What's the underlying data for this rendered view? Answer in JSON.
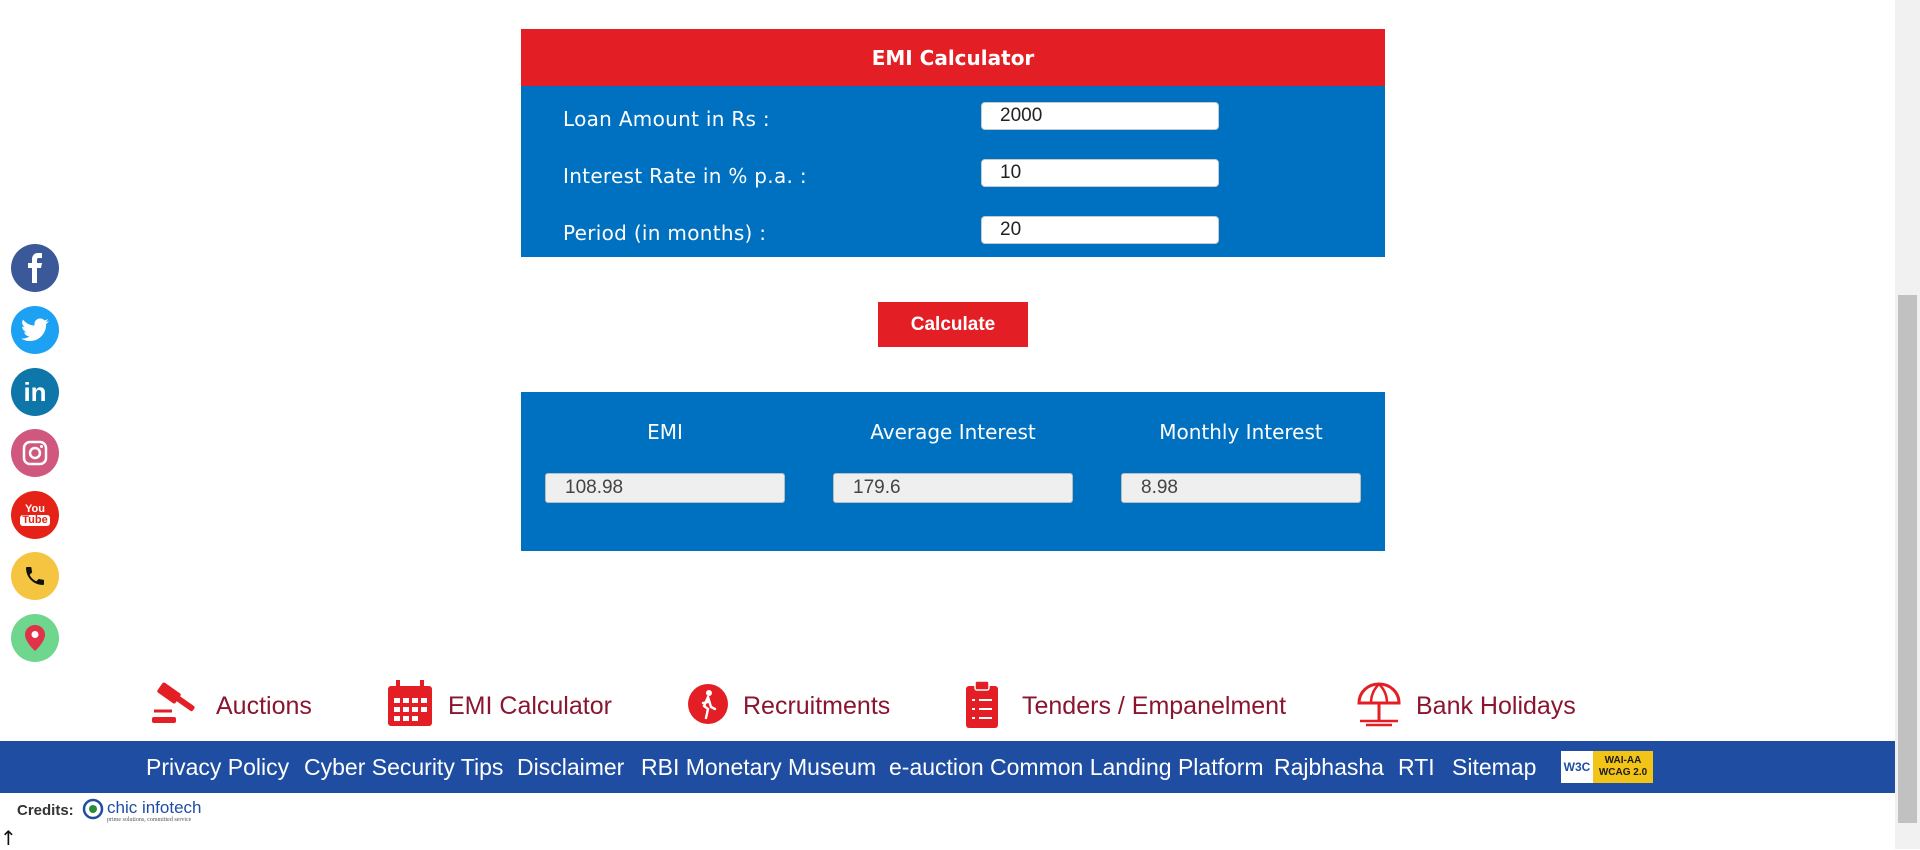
{
  "emi_calculator": {
    "title": "EMI Calculator",
    "fields": [
      {
        "label": "Loan Amount in Rs :",
        "value": "2000"
      },
      {
        "label": "Interest Rate in % p.a. :",
        "value": "10"
      },
      {
        "label": "Period (in months) :",
        "value": "20"
      }
    ],
    "calculate_label": "Calculate",
    "results": [
      {
        "label": "EMI",
        "value": "108.98"
      },
      {
        "label": "Average Interest",
        "value": "179.6"
      },
      {
        "label": "Monthly Interest",
        "value": "8.98"
      }
    ]
  },
  "social_icons": [
    {
      "name": "facebook-icon",
      "color": "#3b5998",
      "glyph": "f"
    },
    {
      "name": "twitter-icon",
      "color": "#1da1f2",
      "glyph": ""
    },
    {
      "name": "linkedin-icon",
      "color": "#0e76a8",
      "glyph": "in"
    },
    {
      "name": "instagram-icon",
      "color": "#d0587e",
      "glyph": ""
    },
    {
      "name": "youtube-icon",
      "color": "#e62117",
      "glyph": ""
    },
    {
      "name": "phone-icon",
      "color": "#f5c542",
      "glyph": ""
    },
    {
      "name": "location-icon",
      "color": "#6fd68d",
      "glyph": ""
    }
  ],
  "quick_links": [
    {
      "label": "Auctions",
      "icon": "gavel-icon"
    },
    {
      "label": "EMI Calculator",
      "icon": "calendar-icon"
    },
    {
      "label": "Recruitments",
      "icon": "walking-person-icon"
    },
    {
      "label": "Tenders / Empanelment",
      "icon": "clipboard-icon"
    },
    {
      "label": "Bank Holidays",
      "icon": "beach-umbrella-icon"
    }
  ],
  "footer_links": [
    "Privacy Policy",
    "Cyber Security Tips",
    "Disclaimer",
    "RBI Monetary Museum",
    "e-auction Common Landing Platform",
    "Rajbhasha",
    "RTI",
    "Sitemap"
  ],
  "wcag_badge": {
    "w3c": "W3C",
    "line1": "WAI-AA",
    "line2": "WCAG 2.0"
  },
  "credits": {
    "label": "Credits:",
    "company": "chic infotech",
    "tagline": "prime solutions, committed service"
  },
  "colors": {
    "accent_red": "#e31e24",
    "panel_blue": "#0070c0",
    "footer_blue": "#1f4da2",
    "link_maroon": "#8a1530"
  }
}
